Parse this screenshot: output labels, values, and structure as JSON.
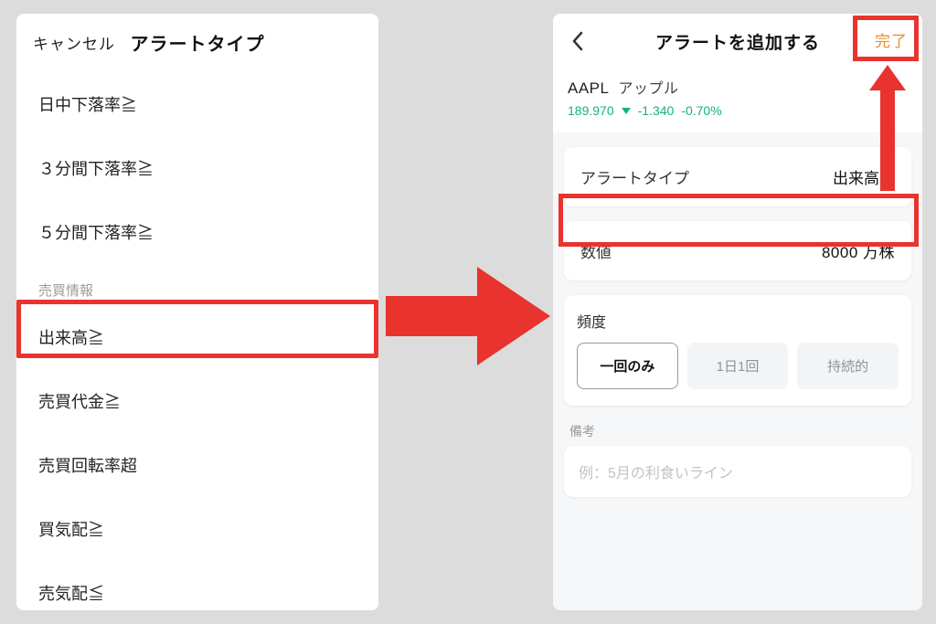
{
  "left": {
    "cancel_label": "キャンセル",
    "title": "アラートタイプ",
    "rows": [
      "日中下落率≧",
      "３分間下落率≧",
      "５分間下落率≧"
    ],
    "section_label": "売買情報",
    "rows2": [
      "出来高≧",
      "売買代金≧",
      "売買回転率超",
      "買気配≧",
      "売気配≦"
    ]
  },
  "right": {
    "title": "アラートを追加する",
    "done_label": "完了",
    "symbol": "AAPL",
    "company": "アップル",
    "price": "189.970",
    "change_abs": "-1.340",
    "change_pct": "-0.70%",
    "alert_type_label": "アラートタイプ",
    "alert_type_value": "出来高≧",
    "value_label": "数値",
    "value_value": "8000 万株",
    "freq_label": "頻度",
    "freq_options": [
      "一回のみ",
      "1日1回",
      "持続的"
    ],
    "freq_selected": 0,
    "notes_label": "備考",
    "notes_placeholder": "例：5月の利食いライン"
  },
  "annotations": {
    "highlight_color": "#e9332e",
    "accent_green": "#12b37c"
  }
}
